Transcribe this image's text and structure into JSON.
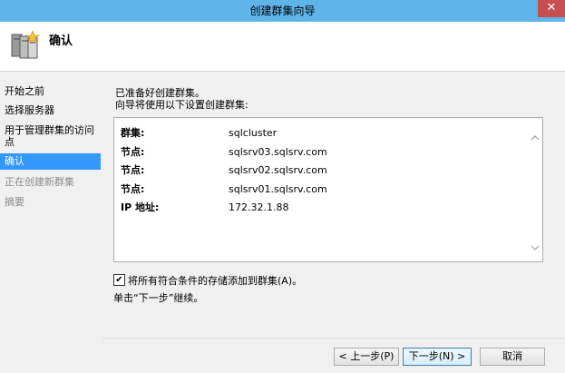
{
  "window": {
    "title": "创建群集向导",
    "close_glyph": "✕"
  },
  "header": {
    "title": "确认",
    "icon": "cluster-servers-icon"
  },
  "sidebar": {
    "steps": [
      {
        "label": "开始之前",
        "state": "normal"
      },
      {
        "label": "选择服务器",
        "state": "normal"
      },
      {
        "label": "用于管理群集的访问点",
        "state": "normal"
      },
      {
        "label": "确认",
        "state": "active"
      },
      {
        "label": "正在创建新群集",
        "state": "disabled"
      },
      {
        "label": "摘要",
        "state": "disabled"
      }
    ]
  },
  "main": {
    "intro_line1": "已准备好创建群集。",
    "intro_line2": "向导将使用以下设置创建群集:",
    "settings": [
      {
        "label": "群集:",
        "value": "sqlcluster"
      },
      {
        "label": "节点:",
        "value": "sqlsrv03.sqlsrv.com"
      },
      {
        "label": "节点:",
        "value": "sqlsrv02.sqlsrv.com"
      },
      {
        "label": "节点:",
        "value": "sqlsrv01.sqlsrv.com"
      },
      {
        "label": "IP 地址:",
        "value": "172.32.1.88"
      }
    ],
    "checkbox": {
      "label": "将所有符合条件的存储添加到群集(A)。",
      "checked": true,
      "glyph": "✔"
    },
    "hint": "单击“下一步”继续。"
  },
  "buttons": {
    "back": "< 上一步(P)",
    "next": "下一步(N) >",
    "cancel": "取消"
  },
  "colors": {
    "titlebar": "#5fb5ea",
    "close": "#c74f50",
    "selection": "#3399ff"
  }
}
